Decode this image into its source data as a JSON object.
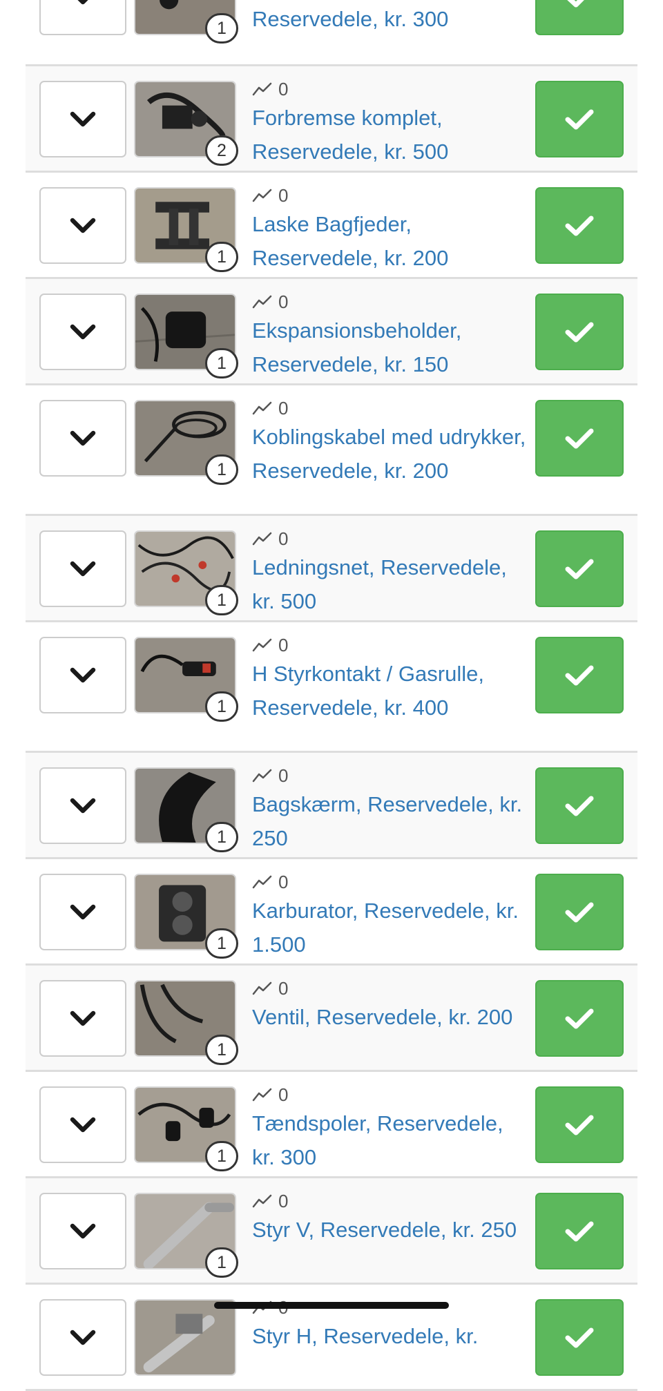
{
  "listings": [
    {
      "count": "1",
      "views": "",
      "title": "Reservedele, kr. 300",
      "image": "partial-item-photo"
    },
    {
      "count": "2",
      "views": "0",
      "title": "Forbremse komplet, Reservedele, kr. 500",
      "image": "brake-parts-photo"
    },
    {
      "count": "1",
      "views": "0",
      "title": "Laske Bagfjeder, Reservedele, kr. 200",
      "image": "rear-spring-bracket-photo"
    },
    {
      "count": "1",
      "views": "0",
      "title": "Ekspansionsbeholder, Reservedele, kr. 150",
      "image": "expansion-tank-photo"
    },
    {
      "count": "1",
      "views": "0",
      "title": "Koblingskabel med udrykker, Reservedele, kr. 200",
      "image": "clutch-cable-photo"
    },
    {
      "count": "1",
      "views": "0",
      "title": "Ledningsnet, Reservedele, kr. 500",
      "image": "wiring-harness-photo"
    },
    {
      "count": "1",
      "views": "0",
      "title": "H Styrkontakt / Gasrulle, Reservedele, kr. 400",
      "image": "throttle-switch-photo"
    },
    {
      "count": "1",
      "views": "0",
      "title": "Bagskærm, Reservedele, kr. 250",
      "image": "rear-fender-photo"
    },
    {
      "count": "1",
      "views": "0",
      "title": "Karburator, Reservedele, kr. 1.500",
      "image": "carburetor-photo"
    },
    {
      "count": "1",
      "views": "0",
      "title": "Ventil, Reservedele, kr. 200",
      "image": "valve-hoses-photo"
    },
    {
      "count": "1",
      "views": "0",
      "title": "Tændspoler, Reservedele, kr. 300",
      "image": "ignition-coils-photo"
    },
    {
      "count": "1",
      "views": "0",
      "title": "Styr V, Reservedele, kr. 250",
      "image": "handlebar-left-photo"
    },
    {
      "count": "",
      "views": "0",
      "title": "Styr H, Reservedele, kr.",
      "image": "handlebar-right-photo"
    }
  ],
  "icons": {
    "expand": "chevron-down-icon",
    "views": "trend-line-icon",
    "approve": "check-icon"
  },
  "colors": {
    "link": "#337ab7",
    "success": "#5cb85c",
    "row_alt": "#f9f9f9",
    "divider": "#dddddd"
  }
}
